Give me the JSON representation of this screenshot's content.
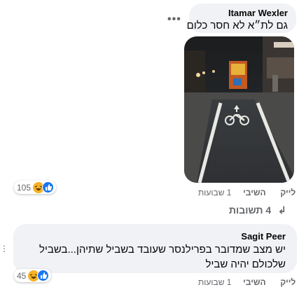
{
  "comment1": {
    "author": "Itamar Wexler",
    "text": "גם לת״א לא חסר כלום",
    "reaction_count": "105",
    "reaction_icons": [
      "haha-icon",
      "like-icon"
    ],
    "actions": {
      "like": "לייק",
      "reply": "השיבי",
      "time": "1 שבועות"
    }
  },
  "replies_link": {
    "count": "4",
    "label": "תשובות"
  },
  "comment2": {
    "author": "Sagit Peer",
    "text": "יש מצב שמדובר בפרילנסר שעובד בשביל שתיהן...בשביל שלכולם יהיה שביל",
    "reaction_count": "45",
    "reaction_icons": [
      "haha-icon",
      "like-icon"
    ],
    "actions": {
      "like": "לייק",
      "reply": "השיבי",
      "time": "1 שבועות"
    }
  },
  "colors": {
    "bubble": "#f0f2f5",
    "secondary_text": "#65676b",
    "like_blue": "#1877f2",
    "haha_yellow": "#f7b125"
  }
}
